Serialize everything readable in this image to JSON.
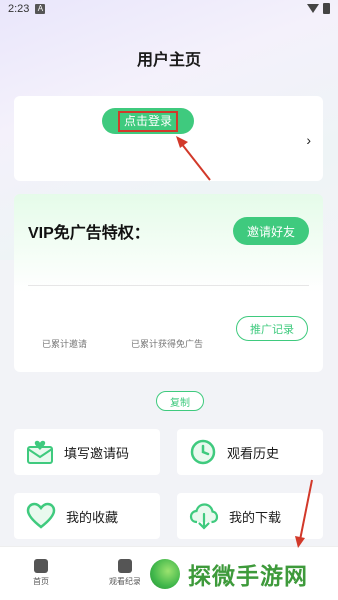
{
  "status_bar": {
    "time": "2:23",
    "notification_letter": "A"
  },
  "header": {
    "title": "用户主页"
  },
  "login_card": {
    "login_label": "点击登录",
    "chevron": "›"
  },
  "vip_card": {
    "title": "VIP免广告特权：",
    "invite_button": "邀请好友",
    "stat_invited": "已累计邀请",
    "stat_ad_free": "已累计获得免广告",
    "promo_button": "推广记录"
  },
  "copy_button": "复制",
  "tiles": [
    {
      "label": "填写邀请码",
      "icon": "envelope-heart-icon"
    },
    {
      "label": "观看历史",
      "icon": "clock-icon"
    },
    {
      "label": "我的收藏",
      "icon": "heart-icon"
    },
    {
      "label": "我的下载",
      "icon": "cloud-download-icon"
    }
  ],
  "tabbar": {
    "tabs": [
      {
        "label": "首页",
        "icon": "home-icon"
      },
      {
        "label": "观看纪录",
        "icon": "chat-icon"
      }
    ]
  },
  "watermark": {
    "text": "探微手游网"
  },
  "colors": {
    "accent": "#3fca7e",
    "annotation_red": "#d2392a"
  }
}
